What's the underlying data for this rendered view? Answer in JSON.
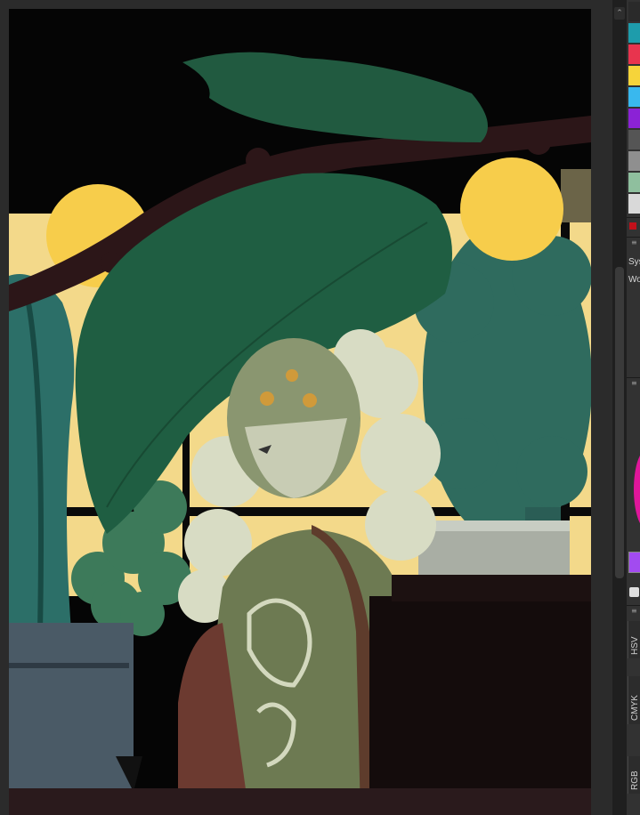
{
  "palette": {
    "swatches": [
      "#2a2a2a",
      "#1e9cab",
      "#e8344e",
      "#f6d43a",
      "#39b8ee",
      "#8b22d6",
      "#555555",
      "#8f8f8f",
      "#8fbf9e",
      "#d9d9d9"
    ],
    "active_color": "#c0101a",
    "color_wheel_color": "#e0169a",
    "picked_color": "#a24bf0"
  },
  "panel": {
    "line1": "Sys",
    "line2": "Wo"
  },
  "color_tabs": [
    {
      "label": "HSV"
    },
    {
      "label": "CMYK"
    },
    {
      "label": "RGB"
    }
  ],
  "scrollbar": {
    "up_arrow": "⌃"
  }
}
